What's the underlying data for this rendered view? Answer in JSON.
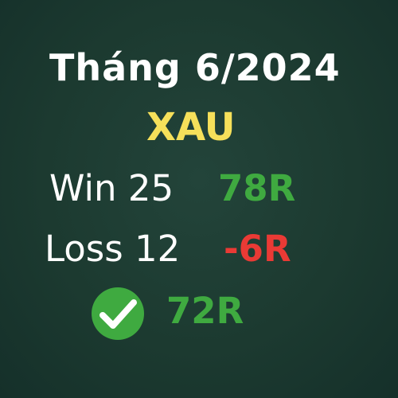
{
  "header": {
    "title": "Tháng 6/2024",
    "symbol": "XAU"
  },
  "stats": {
    "win_label": "Win 25",
    "win_value": "78R",
    "loss_label": "Loss 12",
    "loss_value": "-6R",
    "total_value": "72R",
    "total_icon": "check-circle-icon"
  },
  "colors": {
    "background": "#1c3a30",
    "title": "#ffffff",
    "symbol": "#f6e05a",
    "positive": "#3faa40",
    "negative": "#ea3a35"
  }
}
